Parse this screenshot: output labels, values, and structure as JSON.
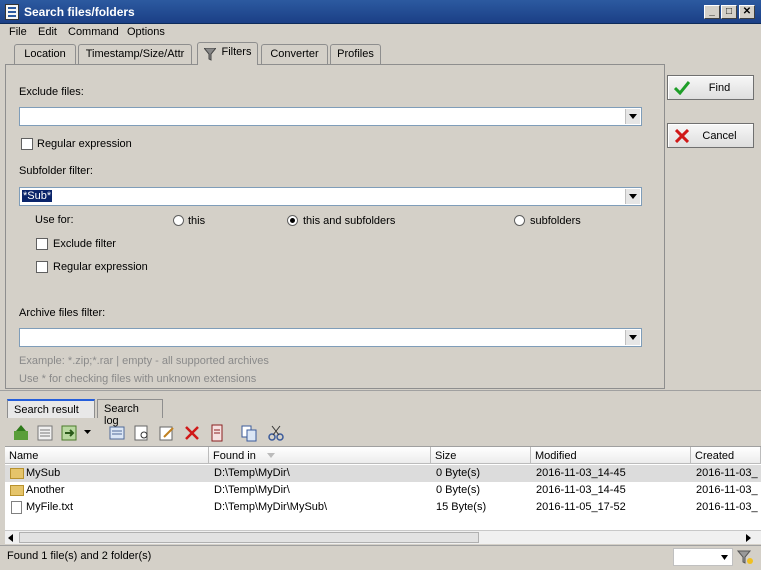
{
  "window": {
    "title": "Search files/folders"
  },
  "menu": [
    "File",
    "Edit",
    "Command",
    "Options"
  ],
  "tabs": [
    "Location",
    "Timestamp/Size/Attr",
    "Filters",
    "Converter",
    "Profiles"
  ],
  "filters": {
    "exclude_files_label": "Exclude files:",
    "exclude_files_value": "",
    "regex1_label": "Regular expression",
    "subfolder_label": "Subfolder filter:",
    "subfolder_value": "*Sub*",
    "use_for_label": "Use for:",
    "use_for_options": [
      "this",
      "this and subfolders",
      "subfolders"
    ],
    "use_for_selected": "this and subfolders",
    "exclude_filter_label": "Exclude filter",
    "regex2_label": "Regular expression",
    "archive_label": "Archive files filter:",
    "archive_value": "",
    "hint1": "Example: *.zip;*.rar | empty - all supported archives",
    "hint2": "Use * for checking files with unknown extensions"
  },
  "buttons": {
    "find": "Find",
    "cancel": "Cancel"
  },
  "bottom_tabs": [
    "Search result",
    "Search log"
  ],
  "columns": [
    "Name",
    "Found in",
    "Size",
    "Modified",
    "Created"
  ],
  "rows": [
    {
      "type": "folder",
      "name": "MySub",
      "found_in": "D:\\Temp\\MyDir\\",
      "size": "0 Byte(s)",
      "modified": "2016-11-03_14-45",
      "created": "2016-11-03_"
    },
    {
      "type": "folder",
      "name": "Another",
      "found_in": "D:\\Temp\\MyDir\\",
      "size": "0 Byte(s)",
      "modified": "2016-11-03_14-45",
      "created": "2016-11-03_"
    },
    {
      "type": "file",
      "name": "MyFile.txt",
      "found_in": "D:\\Temp\\MyDir\\MySub\\",
      "size": "15 Byte(s)",
      "modified": "2016-11-05_17-52",
      "created": "2016-11-03_"
    }
  ],
  "status": "Found 1 file(s) and 2 folder(s)"
}
